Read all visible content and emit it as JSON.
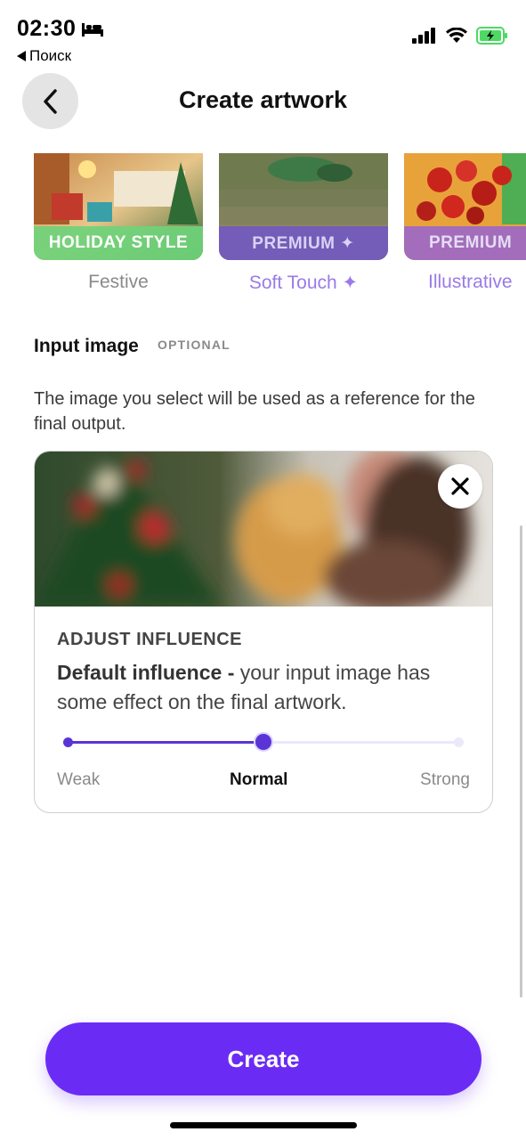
{
  "status_bar": {
    "time": "02:30",
    "back_app": "Поиск"
  },
  "header": {
    "title": "Create artwork"
  },
  "styles": [
    {
      "badge": "HOLIDAY STYLE",
      "label": "Festive",
      "badge_color": "#6fd37a",
      "label_color": "#8a8a8a"
    },
    {
      "badge": "PREMIUM ✦",
      "label": "Soft Touch ✦",
      "badge_color": "#7b5cd6",
      "label_color": "#9a7ae8"
    },
    {
      "badge": "PREMIUM",
      "label": "Illustrative",
      "badge_color": "#9b6ad8",
      "label_color": "#9a7ae8"
    }
  ],
  "input_image": {
    "title": "Input image",
    "optional": "OPTIONAL",
    "description": "The image you select will be used as a reference for the final output."
  },
  "influence": {
    "title": "ADJUST INFLUENCE",
    "bold_text": "Default influence -",
    "text": " your input image has some effect on the final artwork.",
    "labels": {
      "weak": "Weak",
      "normal": "Normal",
      "strong": "Strong"
    },
    "level": 0.5
  },
  "actions": {
    "create": "Create"
  },
  "colors": {
    "accent": "#6a2cf5",
    "slider": "#5b34d6"
  }
}
